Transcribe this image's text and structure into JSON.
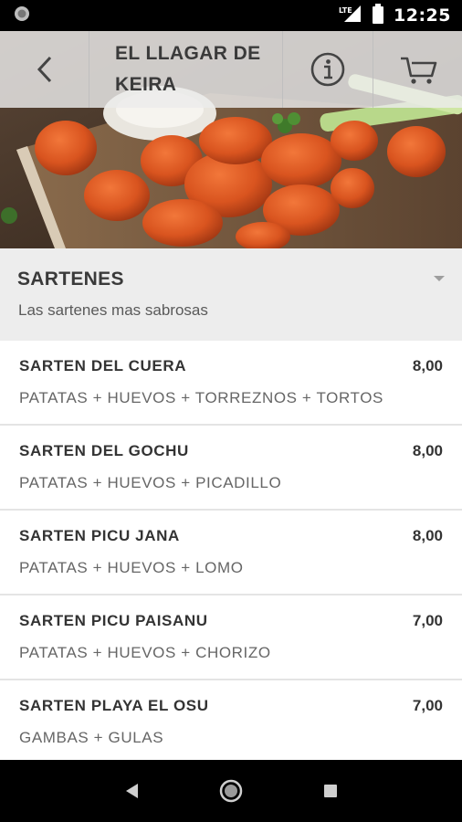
{
  "status_bar": {
    "time": "12:25",
    "network": "LTE"
  },
  "toolbar": {
    "title": "EL LLAGAR DE KEIRA",
    "back_icon": "chevron-left-icon",
    "info_icon": "info-icon",
    "cart_icon": "cart-icon"
  },
  "section": {
    "title": "SARTENES",
    "subtitle": "Las sartenes mas sabrosas",
    "toggle_icon": "caret-down-icon"
  },
  "items": [
    {
      "name": "SARTEN DEL CUERA",
      "price": "8,00",
      "description": "PATATAS + HUEVOS + TORREZNOS + TORTOS"
    },
    {
      "name": "SARTEN DEL GOCHU",
      "price": "8,00",
      "description": "PATATAS + HUEVOS + PICADILLO"
    },
    {
      "name": "SARTEN PICU JANA",
      "price": "8,00",
      "description": "PATATAS + HUEVOS + LOMO"
    },
    {
      "name": "SARTEN PICU PAISANU",
      "price": "7,00",
      "description": "PATATAS + HUEVOS + CHORIZO"
    },
    {
      "name": "SARTEN PLAYA EL OSU",
      "price": "7,00",
      "description": "GAMBAS + GULAS"
    }
  ],
  "colors": {
    "header_bg": "#ededed",
    "text_dark": "#333333",
    "text_muted": "#666666"
  }
}
